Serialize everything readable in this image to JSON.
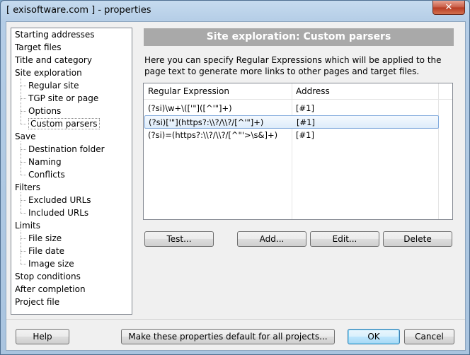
{
  "window": {
    "title": "[ exisoftware.com ] - properties",
    "close_glyph": "✕"
  },
  "tree": [
    {
      "label": "Starting addresses",
      "level": 0
    },
    {
      "label": "Target files",
      "level": 0
    },
    {
      "label": "Title and category",
      "level": 0
    },
    {
      "label": "Site exploration",
      "level": 0
    },
    {
      "label": "Regular site",
      "level": 1
    },
    {
      "label": "TGP site or page",
      "level": 1
    },
    {
      "label": "Options",
      "level": 1
    },
    {
      "label": "Custom parsers",
      "level": 1,
      "selected": true
    },
    {
      "label": "Save",
      "level": 0
    },
    {
      "label": "Destination folder",
      "level": 1
    },
    {
      "label": "Naming",
      "level": 1
    },
    {
      "label": "Conflicts",
      "level": 1
    },
    {
      "label": "Filters",
      "level": 0
    },
    {
      "label": "Excluded URLs",
      "level": 1
    },
    {
      "label": "Included URLs",
      "level": 1
    },
    {
      "label": "Limits",
      "level": 0
    },
    {
      "label": "File size",
      "level": 1
    },
    {
      "label": "File date",
      "level": 1
    },
    {
      "label": "Image size",
      "level": 1
    },
    {
      "label": "Stop conditions",
      "level": 0
    },
    {
      "label": "After completion",
      "level": 0
    },
    {
      "label": "Project file",
      "level": 0
    }
  ],
  "panel": {
    "header": "Site exploration: Custom parsers",
    "description": "Here you can specify Regular Expressions which will be applied to the page text to generate more links to other pages and target files."
  },
  "table": {
    "columns": [
      "Regular Expression",
      "Address"
    ],
    "rows": [
      {
        "regex": "(?si)\\w+\\(['\"]([^'\"]+)",
        "address": "[#1]",
        "selected": false
      },
      {
        "regex": "(?si)['\"](https?:\\\\?/\\\\?/[^'\"]+)",
        "address": "[#1]",
        "selected": true
      },
      {
        "regex": "(?si)=(https?:\\\\?/\\\\?/[^\"'>\\s&]+)",
        "address": "[#1]",
        "selected": false
      }
    ]
  },
  "buttons": {
    "test": "Test...",
    "add": "Add...",
    "edit": "Edit...",
    "delete": "Delete",
    "help": "Help",
    "make_default": "Make these properties default for all projects...",
    "ok": "OK",
    "cancel": "Cancel"
  }
}
